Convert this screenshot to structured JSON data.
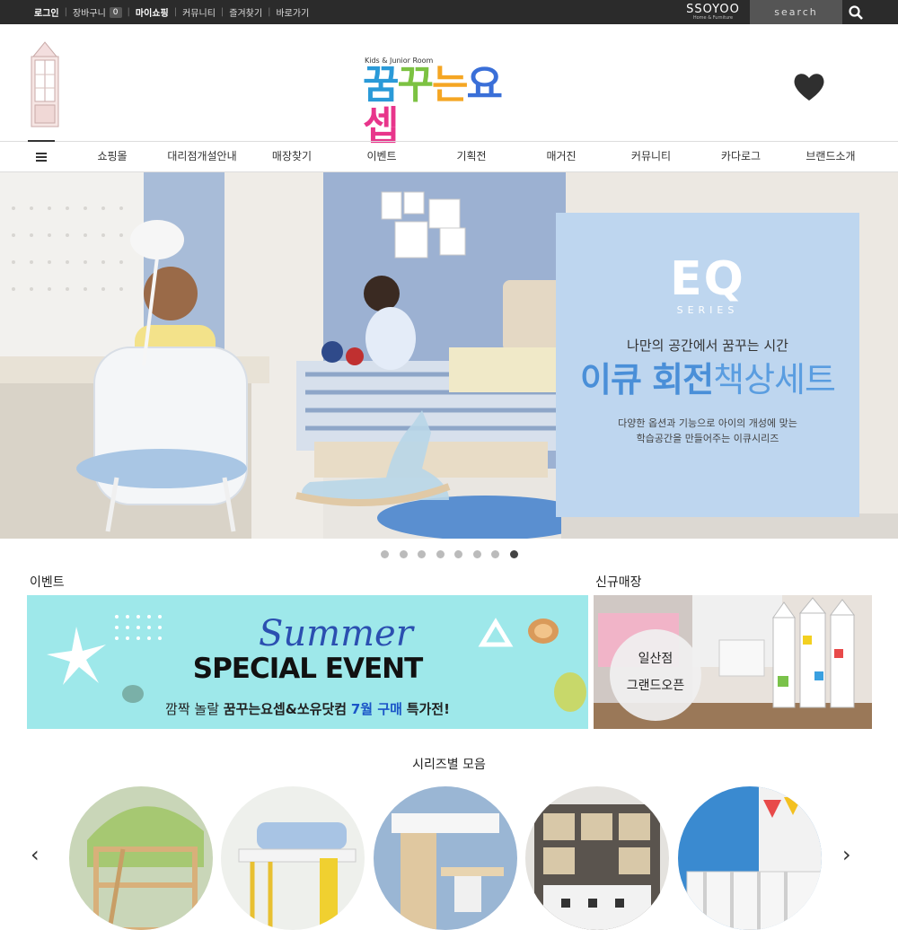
{
  "topbar": {
    "links": [
      "로그인",
      "장바구니",
      "마이쇼핑",
      "커뮤니티",
      "즐겨찾기",
      "바로가기"
    ],
    "cart_count": "0",
    "brand": "SSOYOO",
    "brand_sub": "Home & Furniture",
    "search_placeholder": "search"
  },
  "header": {
    "logo_sub": "Kids & Junior Room",
    "logo_chars": [
      "꿈",
      "꾸",
      "는",
      "요",
      "셉"
    ],
    "logo_colors": [
      "#2a9ad8",
      "#7cc242",
      "#f5a623",
      "#3a6fd8",
      "#e8358b"
    ]
  },
  "nav": {
    "items": [
      "쇼핑몰",
      "대리점개설안내",
      "매장찾기",
      "이벤트",
      "기획전",
      "매거진",
      "커뮤니티",
      "카다로그",
      "브랜드소개"
    ]
  },
  "hero": {
    "eq_logo": "EQ",
    "eq_series": "SERIES",
    "tagline": "나만의 공간에서 꿈꾸는 시간",
    "title_strong": "이큐 회전",
    "title_light": "책상세트",
    "desc_line1": "다양한 옵션과 기능으로 아이의 개성에 맞는",
    "desc_line2": "학습공간을 만들어주는 이큐시리즈",
    "slide_count": 8,
    "active_slide": 8
  },
  "sections": {
    "event_title": "이벤트",
    "store_title": "신규매장",
    "series_title": "시리즈별 모음"
  },
  "event": {
    "script": "Summer",
    "title": "SPECIAL EVENT",
    "sub_pre": "깜짝 놀랄",
    "sub_brand": "꿈꾸는요셉&쏘유닷컴",
    "sub_blue": "7월 구매",
    "sub_post": "특가전!"
  },
  "store": {
    "name": "일산점",
    "open": "그랜드오픈"
  },
  "carousel": {
    "prev": "‹",
    "next": "›"
  }
}
